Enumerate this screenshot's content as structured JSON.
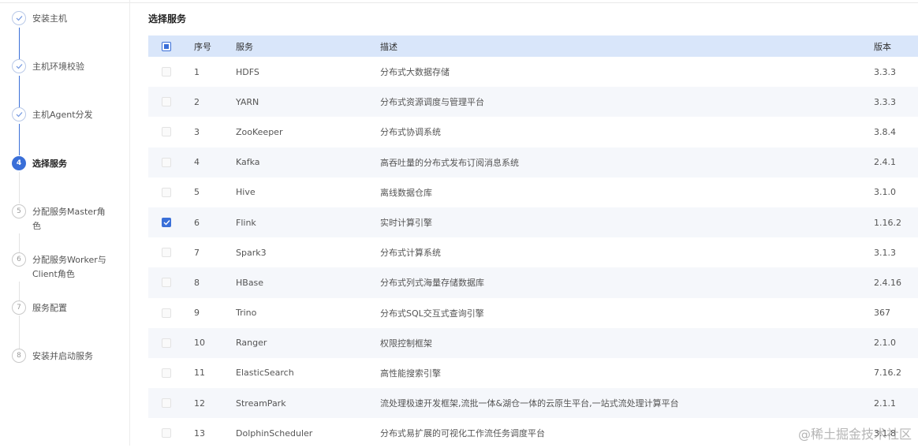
{
  "steps": [
    {
      "number": "1",
      "label": "安装主机",
      "state": "done"
    },
    {
      "number": "2",
      "label": "主机环境校验",
      "state": "done"
    },
    {
      "number": "3",
      "label": "主机Agent分发",
      "state": "done"
    },
    {
      "number": "4",
      "label": "选择服务",
      "state": "active"
    },
    {
      "number": "5",
      "label": "分配服务Master角色",
      "state": "pending"
    },
    {
      "number": "6",
      "label": "分配服务Worker与Client角色",
      "state": "pending"
    },
    {
      "number": "7",
      "label": "服务配置",
      "state": "pending"
    },
    {
      "number": "8",
      "label": "安装并启动服务",
      "state": "pending"
    }
  ],
  "page_title": "选择服务",
  "table": {
    "headers": {
      "index": "序号",
      "service": "服务",
      "description": "描述",
      "version": "版本"
    },
    "rows": [
      {
        "index": "1",
        "service": "HDFS",
        "description": "分布式大数据存储",
        "version": "3.3.3",
        "checked": false
      },
      {
        "index": "2",
        "service": "YARN",
        "description": "分布式资源调度与管理平台",
        "version": "3.3.3",
        "checked": false
      },
      {
        "index": "3",
        "service": "ZooKeeper",
        "description": "分布式协调系统",
        "version": "3.8.4",
        "checked": false
      },
      {
        "index": "4",
        "service": "Kafka",
        "description": "高吞吐量的分布式发布订阅消息系统",
        "version": "2.4.1",
        "checked": false
      },
      {
        "index": "5",
        "service": "Hive",
        "description": "离线数据仓库",
        "version": "3.1.0",
        "checked": false
      },
      {
        "index": "6",
        "service": "Flink",
        "description": "实时计算引擎",
        "version": "1.16.2",
        "checked": true
      },
      {
        "index": "7",
        "service": "Spark3",
        "description": "分布式计算系统",
        "version": "3.1.3",
        "checked": false
      },
      {
        "index": "8",
        "service": "HBase",
        "description": "分布式列式海量存储数据库",
        "version": "2.4.16",
        "checked": false
      },
      {
        "index": "9",
        "service": "Trino",
        "description": "分布式SQL交互式查询引擎",
        "version": "367",
        "checked": false
      },
      {
        "index": "10",
        "service": "Ranger",
        "description": "权限控制框架",
        "version": "2.1.0",
        "checked": false
      },
      {
        "index": "11",
        "service": "ElasticSearch",
        "description": "高性能搜索引擎",
        "version": "7.16.2",
        "checked": false
      },
      {
        "index": "12",
        "service": "StreamPark",
        "description": "流处理极速开发框架,流批一体&湖仓一体的云原生平台,一站式流处理计算平台",
        "version": "2.1.1",
        "checked": false
      },
      {
        "index": "13",
        "service": "DolphinScheduler",
        "description": "分布式易扩展的可视化工作流任务调度平台",
        "version": "3.1.8",
        "checked": false
      }
    ]
  },
  "watermark": "@稀土掘金技术社区",
  "colors": {
    "accent": "#3a6fd8",
    "header_bg": "#d9e6fa",
    "row_alt": "#f5f7fb"
  }
}
